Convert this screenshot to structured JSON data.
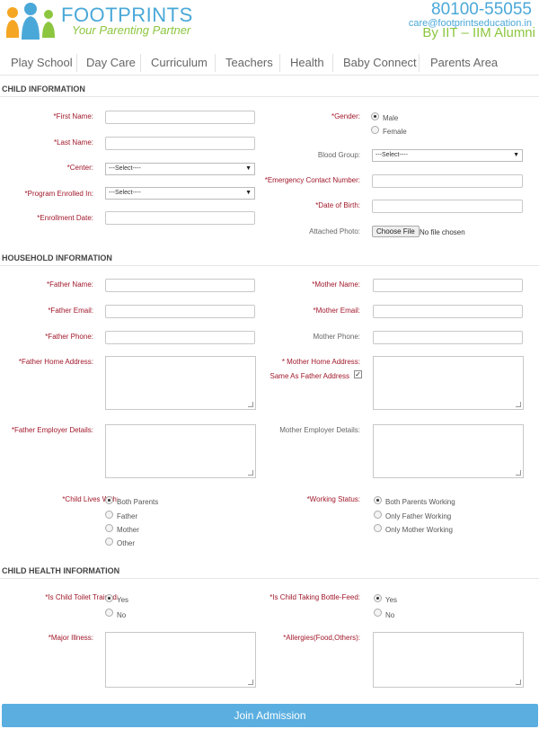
{
  "header": {
    "brand": "FOOTPRINTS",
    "tagline": "Your Parenting Partner",
    "phone": "80100-55055",
    "email": "care@footprintseducation.in",
    "alumni": "By IIT – IIM Alumni"
  },
  "nav": {
    "items": [
      "Play School",
      "Day Care",
      "Curriculum",
      "Teachers",
      "Health",
      "Baby Connect",
      "Parents Area"
    ]
  },
  "child": {
    "title": "CHILD INFORMATION",
    "first_name": "*First Name:",
    "last_name": "*Last Name:",
    "center": "*Center:",
    "center_value": "---Select----",
    "program": "*Program Enrolled In:",
    "program_value": "---Select----",
    "enrollment_date": "*Enrollment Date:",
    "gender": "*Gender:",
    "gender_options": [
      "Male",
      "Female"
    ],
    "blood_group": "Blood Group:",
    "blood_group_value": "---Select----",
    "emergency": "*Emergency Contact Number:",
    "dob": "*Date of Birth:",
    "photo": "Attached Photo:",
    "choose_file": "Choose File",
    "no_file": "No file chosen"
  },
  "household": {
    "title": "HOUSEHOLD INFORMATION",
    "father_name": "*Father Name:",
    "father_email": "*Father Email:",
    "father_phone": "*Father Phone:",
    "father_address": "*Father Home Address:",
    "father_employer": "*Father Employer Details:",
    "mother_name": "*Mother Name:",
    "mother_email": "*Mother Email:",
    "mother_phone": "Mother Phone:",
    "mother_address": "* Mother Home Address:",
    "same_as_father": "Same As Father Address",
    "mother_employer": "Mother Employer Details:",
    "lives_with": "*Child Lives With:",
    "lives_with_options": [
      "Both Parents",
      "Father",
      "Mother",
      "Other"
    ],
    "working_status": "*Working Status:",
    "working_options": [
      "Both Parents Working",
      "Only Father Working",
      "Only Mother Working"
    ]
  },
  "health": {
    "title": "CHILD HEALTH INFORMATION",
    "toilet": "*Is Child Toilet Trained:",
    "toilet_options": [
      "Yes",
      "No"
    ],
    "bottle": "*Is Child Taking Bottle-Feed:",
    "bottle_options": [
      "Yes",
      "No"
    ],
    "illness": "*Major Illness:",
    "allergies": "*Allergies(Food,Others):"
  },
  "submit_label": "Join Admission"
}
